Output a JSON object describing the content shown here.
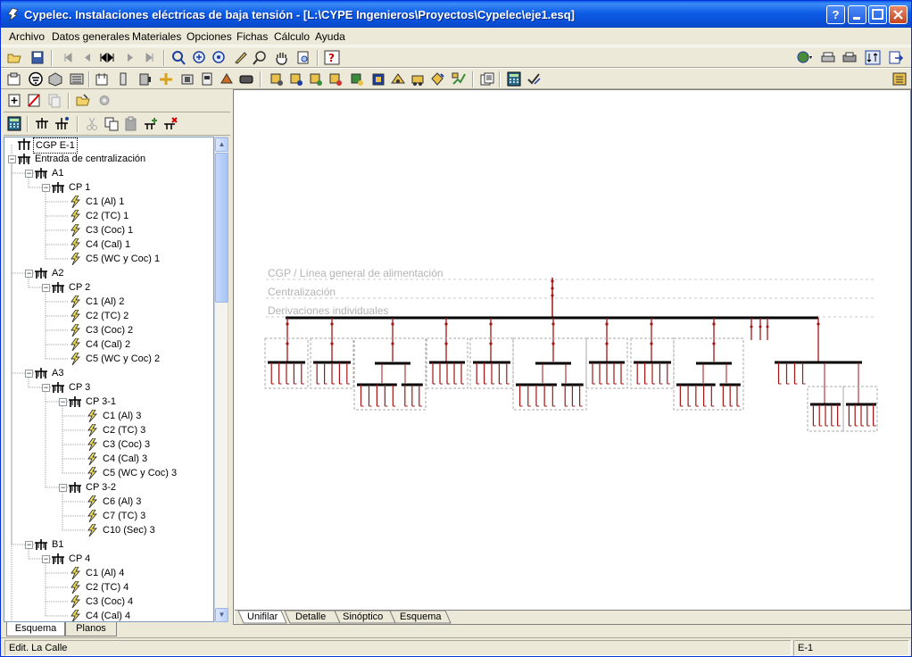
{
  "window": {
    "title": "Cypelec. Instalaciones eléctricas de baja tensión - [L:\\CYPE Ingenieros\\Proyectos\\Cypelec\\eje1.esq]"
  },
  "menu": [
    "Archivo",
    "Datos generales",
    "Materiales",
    "Opciones",
    "Fichas",
    "Cálculo",
    "Ayuda"
  ],
  "tree": [
    {
      "label": "CGP E-1",
      "level": 0,
      "icon": "cgp",
      "selected": true
    },
    {
      "label": "Entrada de centralización",
      "level": 0,
      "icon": "centralizacion",
      "exp": "-"
    },
    {
      "label": "A1",
      "level": 1,
      "icon": "centralizacion",
      "exp": "-"
    },
    {
      "label": "CP 1",
      "level": 2,
      "icon": "centralizacion",
      "exp": "-"
    },
    {
      "label": "C1 (Al) 1",
      "level": 3,
      "icon": "circuit"
    },
    {
      "label": "C2 (TC) 1",
      "level": 3,
      "icon": "circuit"
    },
    {
      "label": "C3 (Coc) 1",
      "level": 3,
      "icon": "circuit"
    },
    {
      "label": "C4 (Cal) 1",
      "level": 3,
      "icon": "circuit"
    },
    {
      "label": "C5 (WC y Coc) 1",
      "level": 3,
      "icon": "circuit"
    },
    {
      "label": "A2",
      "level": 1,
      "icon": "centralizacion",
      "exp": "-"
    },
    {
      "label": "CP 2",
      "level": 2,
      "icon": "centralizacion",
      "exp": "-"
    },
    {
      "label": "C1 (Al) 2",
      "level": 3,
      "icon": "circuit"
    },
    {
      "label": "C2 (TC) 2",
      "level": 3,
      "icon": "circuit"
    },
    {
      "label": "C3 (Coc) 2",
      "level": 3,
      "icon": "circuit"
    },
    {
      "label": "C4 (Cal) 2",
      "level": 3,
      "icon": "circuit"
    },
    {
      "label": "C5 (WC y Coc) 2",
      "level": 3,
      "icon": "circuit"
    },
    {
      "label": "A3",
      "level": 1,
      "icon": "centralizacion",
      "exp": "-"
    },
    {
      "label": "CP 3",
      "level": 2,
      "icon": "centralizacion",
      "exp": "-"
    },
    {
      "label": "CP 3-1",
      "level": 3,
      "icon": "centralizacion",
      "exp": "-"
    },
    {
      "label": "C1 (Al) 3",
      "level": 4,
      "icon": "circuit"
    },
    {
      "label": "C2 (TC) 3",
      "level": 4,
      "icon": "circuit"
    },
    {
      "label": "C3 (Coc) 3",
      "level": 4,
      "icon": "circuit"
    },
    {
      "label": "C4 (Cal) 3",
      "level": 4,
      "icon": "circuit"
    },
    {
      "label": "C5 (WC y Coc) 3",
      "level": 4,
      "icon": "circuit"
    },
    {
      "label": "CP 3-2",
      "level": 3,
      "icon": "centralizacion",
      "exp": "-"
    },
    {
      "label": "C6 (Al) 3",
      "level": 4,
      "icon": "circuit"
    },
    {
      "label": "C7 (TC) 3",
      "level": 4,
      "icon": "circuit"
    },
    {
      "label": "C10 (Sec) 3",
      "level": 4,
      "icon": "circuit"
    },
    {
      "label": "B1",
      "level": 1,
      "icon": "centralizacion",
      "exp": "-"
    },
    {
      "label": "CP 4",
      "level": 2,
      "icon": "centralizacion",
      "exp": "-"
    },
    {
      "label": "C1 (Al) 4",
      "level": 3,
      "icon": "circuit"
    },
    {
      "label": "C2 (TC) 4",
      "level": 3,
      "icon": "circuit"
    },
    {
      "label": "C3 (Coc) 4",
      "level": 3,
      "icon": "circuit"
    },
    {
      "label": "C4 (Cal) 4",
      "level": 3,
      "icon": "circuit"
    }
  ],
  "left_tabs": [
    "Esquema",
    "Planos"
  ],
  "bottom_tabs": [
    "Unifilar",
    "Detalle",
    "Sinóptico",
    "Esquema"
  ],
  "diagram": {
    "level_labels": [
      "CGP / Línea general de alimentación",
      "Centralización",
      "Derivaciones individuales"
    ]
  },
  "status": {
    "left": "Edit. La Calle",
    "right": "E-1"
  },
  "colors": {
    "wire": "#a31515",
    "bus": "#000000",
    "guide": "#c8c8c8"
  }
}
